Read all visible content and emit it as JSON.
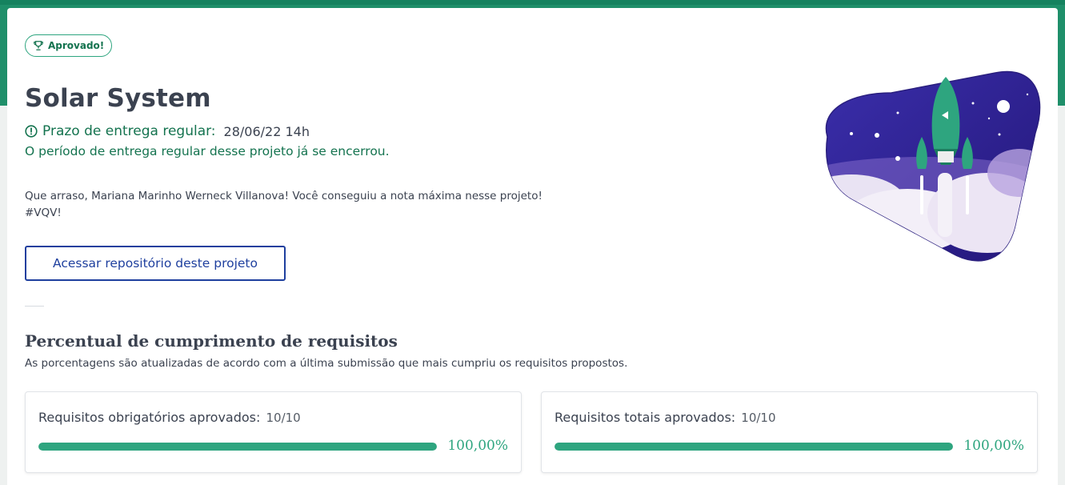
{
  "badge": {
    "label": "Aprovado!",
    "icon": "trophy-icon"
  },
  "project": {
    "title": "Solar System",
    "deadline_label": "Prazo de entrega regular:",
    "deadline_value": "28/06/22 14h",
    "closed_message": "O período de entrega regular desse projeto já se encerrou.",
    "congrats_line1": "Que arraso, Mariana Marinho Werneck Villanova! Você conseguiu a nota máxima nesse projeto!",
    "congrats_line2": "#VQV!",
    "repo_button": "Acessar repositório deste projeto"
  },
  "requirements": {
    "title": "Percentual de cumprimento de requisitos",
    "subtitle": "As porcentagens são atualizadas de acordo com a última submissão que mais cumpriu os requisitos propostos.",
    "cards": [
      {
        "label": "Requisitos obrigatórios aprovados:",
        "count": "10/10",
        "percent_text": "100,00%",
        "progress": 1.0
      },
      {
        "label": "Requisitos totais aprovados:",
        "count": "10/10",
        "percent_text": "100,00%",
        "progress": 1.0
      }
    ]
  },
  "colors": {
    "accent_green": "#2ea57f",
    "dark_green": "#14734f",
    "link_blue": "#1e3f9e",
    "space_purple": "#3b2a9e"
  }
}
